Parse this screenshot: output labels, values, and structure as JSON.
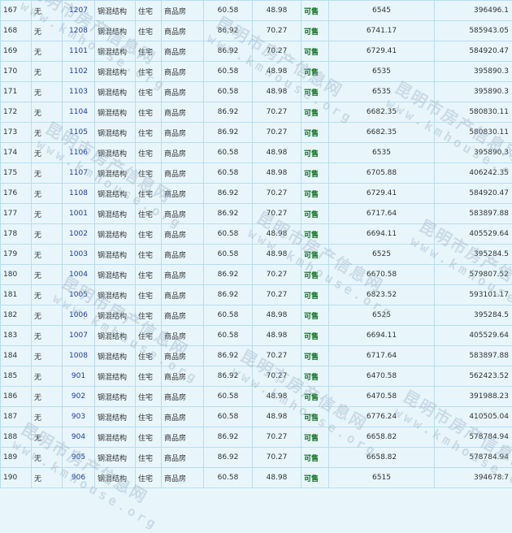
{
  "watermark": {
    "brand": "昆明市房产信息网",
    "url": "www.kmhouse.org"
  },
  "rows": [
    {
      "no": "167",
      "mark": "无",
      "room": "1207",
      "structure": "钢混结构",
      "use": "住宅",
      "type": "商品房",
      "area": "60.58",
      "inner": "48.98",
      "status": "可售",
      "price": "6545",
      "total": "396496.1"
    },
    {
      "no": "168",
      "mark": "无",
      "room": "1208",
      "structure": "钢混结构",
      "use": "住宅",
      "type": "商品房",
      "area": "86.92",
      "inner": "70.27",
      "status": "可售",
      "price": "6741.17",
      "total": "585943.05"
    },
    {
      "no": "169",
      "mark": "无",
      "room": "1101",
      "structure": "钢混结构",
      "use": "住宅",
      "type": "商品房",
      "area": "86.92",
      "inner": "70.27",
      "status": "可售",
      "price": "6729.41",
      "total": "584920.47"
    },
    {
      "no": "170",
      "mark": "无",
      "room": "1102",
      "structure": "钢混结构",
      "use": "住宅",
      "type": "商品房",
      "area": "60.58",
      "inner": "48.98",
      "status": "可售",
      "price": "6535",
      "total": "395890.3"
    },
    {
      "no": "171",
      "mark": "无",
      "room": "1103",
      "structure": "钢混结构",
      "use": "住宅",
      "type": "商品房",
      "area": "60.58",
      "inner": "48.98",
      "status": "可售",
      "price": "6535",
      "total": "395890.3"
    },
    {
      "no": "172",
      "mark": "无",
      "room": "1104",
      "structure": "钢混结构",
      "use": "住宅",
      "type": "商品房",
      "area": "86.92",
      "inner": "70.27",
      "status": "可售",
      "price": "6682.35",
      "total": "580830.11"
    },
    {
      "no": "173",
      "mark": "无",
      "room": "1105",
      "structure": "钢混结构",
      "use": "住宅",
      "type": "商品房",
      "area": "86.92",
      "inner": "70.27",
      "status": "可售",
      "price": "6682.35",
      "total": "580830.11"
    },
    {
      "no": "174",
      "mark": "无",
      "room": "1106",
      "structure": "钢混结构",
      "use": "住宅",
      "type": "商品房",
      "area": "60.58",
      "inner": "48.98",
      "status": "可售",
      "price": "6535",
      "total": "395890.3"
    },
    {
      "no": "175",
      "mark": "无",
      "room": "1107",
      "structure": "钢混结构",
      "use": "住宅",
      "type": "商品房",
      "area": "60.58",
      "inner": "48.98",
      "status": "可售",
      "price": "6705.88",
      "total": "406242.35"
    },
    {
      "no": "176",
      "mark": "无",
      "room": "1108",
      "structure": "钢混结构",
      "use": "住宅",
      "type": "商品房",
      "area": "86.92",
      "inner": "70.27",
      "status": "可售",
      "price": "6729.41",
      "total": "584920.47"
    },
    {
      "no": "177",
      "mark": "无",
      "room": "1001",
      "structure": "钢混结构",
      "use": "住宅",
      "type": "商品房",
      "area": "86.92",
      "inner": "70.27",
      "status": "可售",
      "price": "6717.64",
      "total": "583897.88"
    },
    {
      "no": "178",
      "mark": "无",
      "room": "1002",
      "structure": "钢混结构",
      "use": "住宅",
      "type": "商品房",
      "area": "60.58",
      "inner": "48.98",
      "status": "可售",
      "price": "6694.11",
      "total": "405529.64"
    },
    {
      "no": "179",
      "mark": "无",
      "room": "1003",
      "structure": "钢混结构",
      "use": "住宅",
      "type": "商品房",
      "area": "60.58",
      "inner": "48.98",
      "status": "可售",
      "price": "6525",
      "total": "395284.5"
    },
    {
      "no": "180",
      "mark": "无",
      "room": "1004",
      "structure": "钢混结构",
      "use": "住宅",
      "type": "商品房",
      "area": "86.92",
      "inner": "70.27",
      "status": "可售",
      "price": "6670.58",
      "total": "579807.52"
    },
    {
      "no": "181",
      "mark": "无",
      "room": "1005",
      "structure": "钢混结构",
      "use": "住宅",
      "type": "商品房",
      "area": "86.92",
      "inner": "70.27",
      "status": "可售",
      "price": "6823.52",
      "total": "593101.17"
    },
    {
      "no": "182",
      "mark": "无",
      "room": "1006",
      "structure": "钢混结构",
      "use": "住宅",
      "type": "商品房",
      "area": "60.58",
      "inner": "48.98",
      "status": "可售",
      "price": "6525",
      "total": "395284.5"
    },
    {
      "no": "183",
      "mark": "无",
      "room": "1007",
      "structure": "钢混结构",
      "use": "住宅",
      "type": "商品房",
      "area": "60.58",
      "inner": "48.98",
      "status": "可售",
      "price": "6694.11",
      "total": "405529.64"
    },
    {
      "no": "184",
      "mark": "无",
      "room": "1008",
      "structure": "钢混结构",
      "use": "住宅",
      "type": "商品房",
      "area": "86.92",
      "inner": "70.27",
      "status": "可售",
      "price": "6717.64",
      "total": "583897.88"
    },
    {
      "no": "185",
      "mark": "无",
      "room": "901",
      "structure": "钢混结构",
      "use": "住宅",
      "type": "商品房",
      "area": "86.92",
      "inner": "70.27",
      "status": "可售",
      "price": "6470.58",
      "total": "562423.52"
    },
    {
      "no": "186",
      "mark": "无",
      "room": "902",
      "structure": "钢混结构",
      "use": "住宅",
      "type": "商品房",
      "area": "60.58",
      "inner": "48.98",
      "status": "可售",
      "price": "6470.58",
      "total": "391988.23"
    },
    {
      "no": "187",
      "mark": "无",
      "room": "903",
      "structure": "钢混结构",
      "use": "住宅",
      "type": "商品房",
      "area": "60.58",
      "inner": "48.98",
      "status": "可售",
      "price": "6776.24",
      "total": "410505.04"
    },
    {
      "no": "188",
      "mark": "无",
      "room": "904",
      "structure": "钢混结构",
      "use": "住宅",
      "type": "商品房",
      "area": "86.92",
      "inner": "70.27",
      "status": "可售",
      "price": "6658.82",
      "total": "578784.94"
    },
    {
      "no": "189",
      "mark": "无",
      "room": "905",
      "structure": "钢混结构",
      "use": "住宅",
      "type": "商品房",
      "area": "86.92",
      "inner": "70.27",
      "status": "可售",
      "price": "6658.82",
      "total": "578784.94"
    },
    {
      "no": "190",
      "mark": "无",
      "room": "906",
      "structure": "钢混结构",
      "use": "住宅",
      "type": "商品房",
      "area": "60.58",
      "inner": "48.98",
      "status": "可售",
      "price": "6515",
      "total": "394678.7"
    }
  ]
}
